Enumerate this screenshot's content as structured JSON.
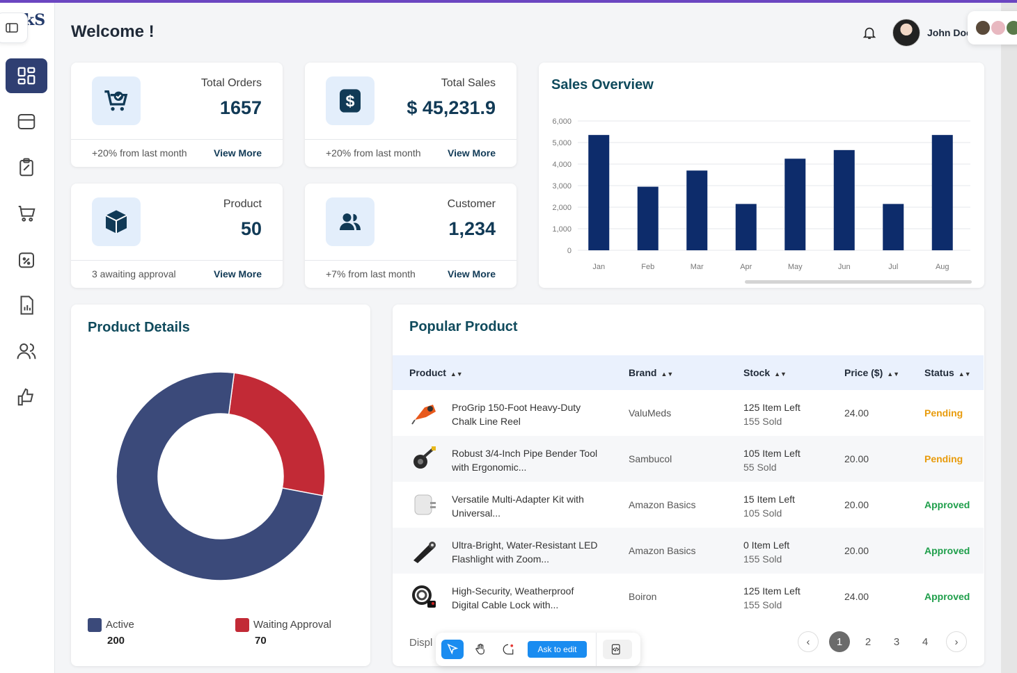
{
  "app": {
    "logo_text": "kS"
  },
  "header": {
    "welcome": "Welcome !",
    "user_name": "John Doe"
  },
  "stats": [
    {
      "label": "Total Orders",
      "value": "1657",
      "footnote": "+20% from last month",
      "action": "View More"
    },
    {
      "label": "Total Sales",
      "value": "$ 45,231.9",
      "footnote": "+20% from last month",
      "action": "View More"
    },
    {
      "label": "Product",
      "value": "50",
      "footnote": "3 awaiting approval",
      "action": "View More"
    },
    {
      "label": "Customer",
      "value": "1,234",
      "footnote": "+7% from last month",
      "action": "View More"
    }
  ],
  "sales_overview": {
    "title": "Sales Overview"
  },
  "product_details": {
    "title": "Product Details",
    "legend": [
      {
        "label": "Active",
        "value": "200",
        "color": "#3b4a7a"
      },
      {
        "label": "Waiting Approval",
        "value": "70",
        "color": "#c22a36"
      }
    ]
  },
  "popular": {
    "title": "Popular Product",
    "columns": [
      "Product",
      "Brand",
      "Stock",
      "Price ($)",
      "Status"
    ],
    "rows": [
      {
        "name1": "ProGrip 150-Foot Heavy-Duty",
        "name2": "Chalk Line Reel",
        "brand": "ValuMeds",
        "stock": "125 Item Left",
        "sold": "155 Sold",
        "price": "24.00",
        "status": "Pending"
      },
      {
        "name1": "Robust 3/4-Inch Pipe Bender Tool",
        "name2": "with Ergonomic...",
        "brand": "Sambucol",
        "stock": "105 Item Left",
        "sold": "55 Sold",
        "price": "20.00",
        "status": "Pending"
      },
      {
        "name1": "Versatile Multi-Adapter Kit with",
        "name2": "Universal...",
        "brand": "Amazon Basics",
        "stock": "15 Item Left",
        "sold": "105 Sold",
        "price": "20.00",
        "status": "Approved"
      },
      {
        "name1": "Ultra-Bright, Water-Resistant LED",
        "name2": "Flashlight with Zoom...",
        "brand": "Amazon Basics",
        "stock": "0 Item Left",
        "sold": "155 Sold",
        "price": "20.00",
        "status": "Approved"
      },
      {
        "name1": "High-Security, Weatherproof",
        "name2": "Digital Cable Lock with...",
        "brand": "Boiron",
        "stock": "125 Item Left",
        "sold": "155 Sold",
        "price": "24.00",
        "status": "Approved"
      }
    ],
    "display_text": "Displ",
    "pages": [
      "1",
      "2",
      "3",
      "4"
    ],
    "prev_icon": "‹",
    "next_icon": "›"
  },
  "toolbar": {
    "ask_label": "Ask to edit"
  },
  "colors": {
    "pending": "#e89b0c",
    "approved": "#1e9e4a",
    "bar": "#0d2c6b"
  },
  "chart_data": {
    "type": "bar",
    "title": "Sales Overview",
    "categories": [
      "Jan",
      "Feb",
      "Mar",
      "Apr",
      "May",
      "Jun",
      "Jul",
      "Aug"
    ],
    "values": [
      5350,
      2950,
      3700,
      2150,
      4250,
      4650,
      2150,
      5350
    ],
    "yticks": [
      "0",
      "1,000",
      "2,000",
      "3,000",
      "4,000",
      "5,000",
      "6,000"
    ],
    "ylim": [
      0,
      6000
    ],
    "grid": true
  },
  "donut_data": {
    "type": "pie",
    "series": [
      {
        "label": "Active",
        "value": 200
      },
      {
        "label": "Waiting Approval",
        "value": 70
      }
    ]
  }
}
